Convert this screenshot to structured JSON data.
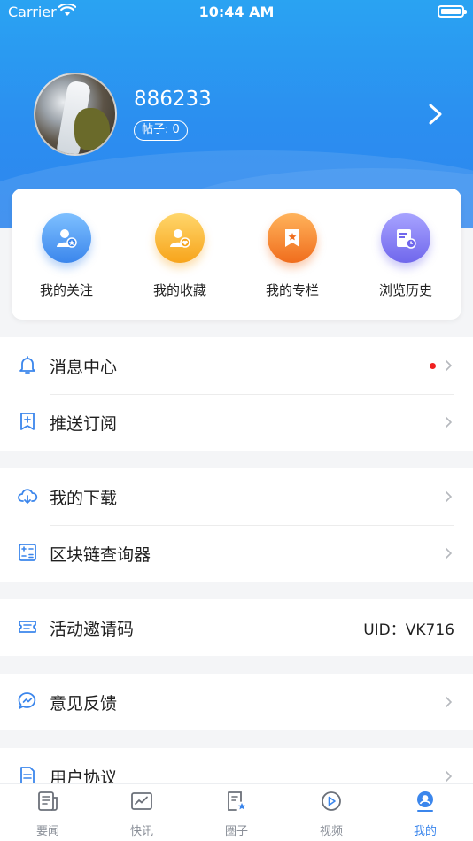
{
  "status_bar": {
    "carrier": "Carrier",
    "time": "10:44 AM"
  },
  "profile": {
    "username": "886233",
    "posts_badge": "帖子: 0"
  },
  "shortcuts": [
    {
      "label": "我的关注",
      "icon": "user-star-icon",
      "color": "#3b86ec"
    },
    {
      "label": "我的收藏",
      "icon": "user-heart-icon",
      "color": "#f7a41b"
    },
    {
      "label": "我的专栏",
      "icon": "bookmark-star-icon",
      "color": "#f06d1d"
    },
    {
      "label": "浏览历史",
      "icon": "document-clock-icon",
      "color": "#7067ec"
    }
  ],
  "menu": {
    "messages": {
      "label": "消息中心",
      "icon": "bell-icon",
      "has_unread_dot": true
    },
    "push_subscription": {
      "label": "推送订阅",
      "icon": "bookmark-plus-icon"
    },
    "downloads": {
      "label": "我的下载",
      "icon": "cloud-download-icon"
    },
    "blockchain_explorer": {
      "label": "区块链查询器",
      "icon": "calculator-icon"
    },
    "invite_code": {
      "label": "活动邀请码",
      "icon": "ticket-icon",
      "value": "UID：VK716"
    },
    "feedback": {
      "label": "意见反馈",
      "icon": "chat-bubble-icon"
    },
    "user_agreement": {
      "label": "用户协议",
      "icon": "document-icon"
    }
  },
  "tabbar": {
    "tabs": [
      {
        "label": "要闻",
        "icon": "newspaper-icon",
        "active": false
      },
      {
        "label": "快讯",
        "icon": "chart-line-icon",
        "active": false
      },
      {
        "label": "圈子",
        "icon": "note-star-icon",
        "active": false
      },
      {
        "label": "视频",
        "icon": "play-circle-icon",
        "active": false
      },
      {
        "label": "我的",
        "icon": "user-avatar-icon",
        "active": true
      }
    ]
  },
  "colors": {
    "accent": "#3b86ec",
    "header_gradient_top": "#2aa3f2",
    "unread_dot": "#f02020"
  }
}
